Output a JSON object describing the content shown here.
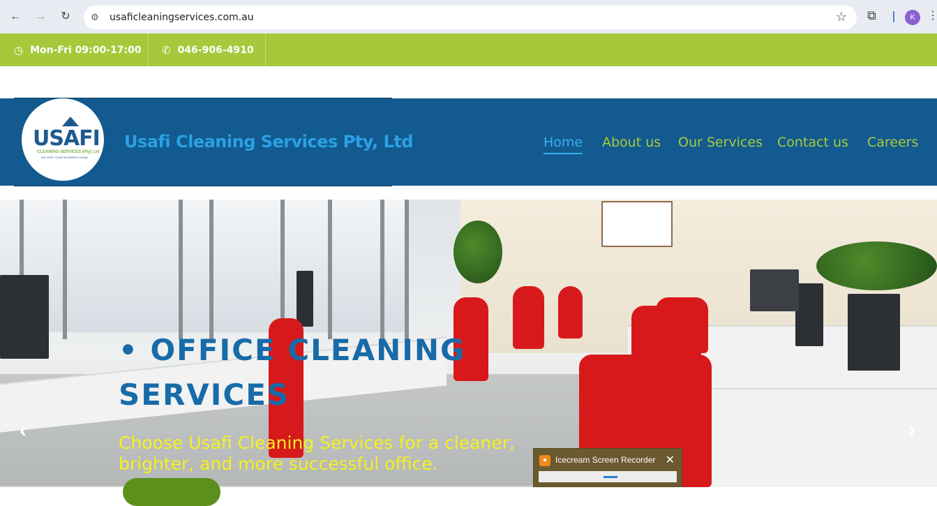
{
  "browser": {
    "url": "usaficleaningservices.com.au",
    "profile_initial": "K",
    "back_icon": "arrow-left-icon",
    "forward_icon": "arrow-right-icon",
    "reload_icon": "reload-icon"
  },
  "topbar": {
    "hours": "Mon-Fri 09:00-17:00",
    "phone": "046-906-4910",
    "background": "#a5c93a"
  },
  "header": {
    "company_name": "Usafi Cleaning Services Pty, Ltd",
    "background": "#125a8f",
    "logo": {
      "main_text": "USAFI",
      "sub_text": "CLEANING SERVICES (Pty) Ltd",
      "tagline": "WE KEEP YOUR BUSINESS CLEAN"
    },
    "nav": [
      {
        "label": "Home",
        "active": true
      },
      {
        "label": "About us",
        "active": false
      },
      {
        "label": "Our Services",
        "active": false
      },
      {
        "label": "Contact us",
        "active": false
      },
      {
        "label": "Careers",
        "active": false
      }
    ]
  },
  "hero": {
    "title": "• OFFICE CLEANING SERVICES",
    "subtitle": "Choose Usafi Cleaning Services for a cleaner, brighter, and more successful office.",
    "prev_icon": "chevron-left-icon",
    "next_icon": "chevron-right-icon"
  },
  "recorder": {
    "title": "Icecream Screen Recorder"
  }
}
